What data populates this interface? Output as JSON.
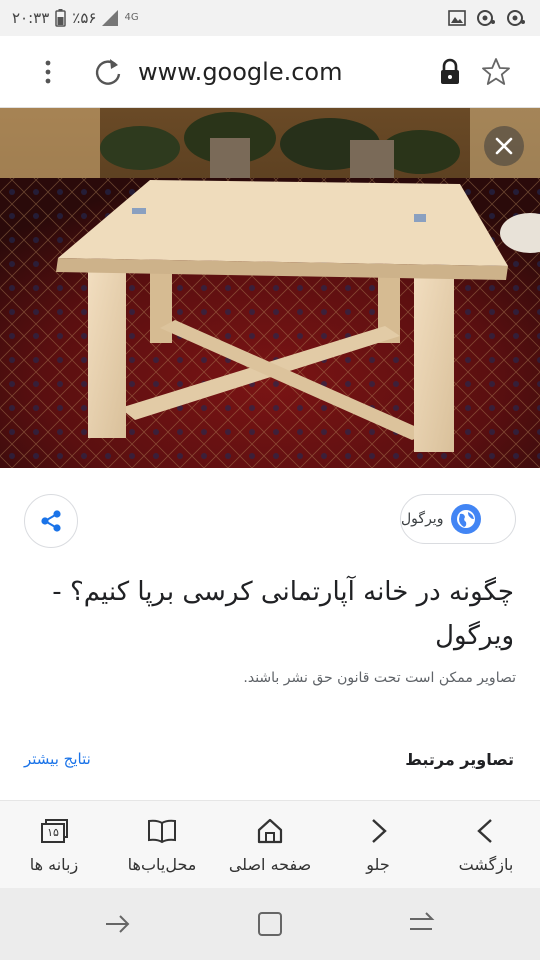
{
  "status_bar": {
    "time": "۲۰:۳۳",
    "battery": "٪۵۶",
    "network": "4G"
  },
  "browser": {
    "url": "www.google.com",
    "icons": [
      "more-vert-icon",
      "reload-icon",
      "lock-icon",
      "star-icon"
    ]
  },
  "viewer": {
    "source_name": "ویرگول",
    "title": "چگونه در خانه آپارتمانی کرسی برپا کنیم؟ - ویرگول",
    "copyright_note": "تصاویر ممکن است تحت قانون حق نشر باشند.",
    "related_images_label": "تصاویر مرتبط",
    "more_results_label": "نتایج بیشتر"
  },
  "toolbar": {
    "items": [
      {
        "label": "بازگشت",
        "icon": "chevron-left-icon"
      },
      {
        "label": "جلو",
        "icon": "chevron-forward-icon"
      },
      {
        "label": "صفحه اصلی",
        "icon": "home-icon"
      },
      {
        "label": "محل‌یاب‌ها",
        "icon": "bookmarks-icon"
      },
      {
        "label": "زبانه ها",
        "icon": "tabs-icon",
        "badge": "۱۵"
      }
    ]
  },
  "colors": {
    "link": "#1a73e8",
    "globe": "#4285f4"
  }
}
